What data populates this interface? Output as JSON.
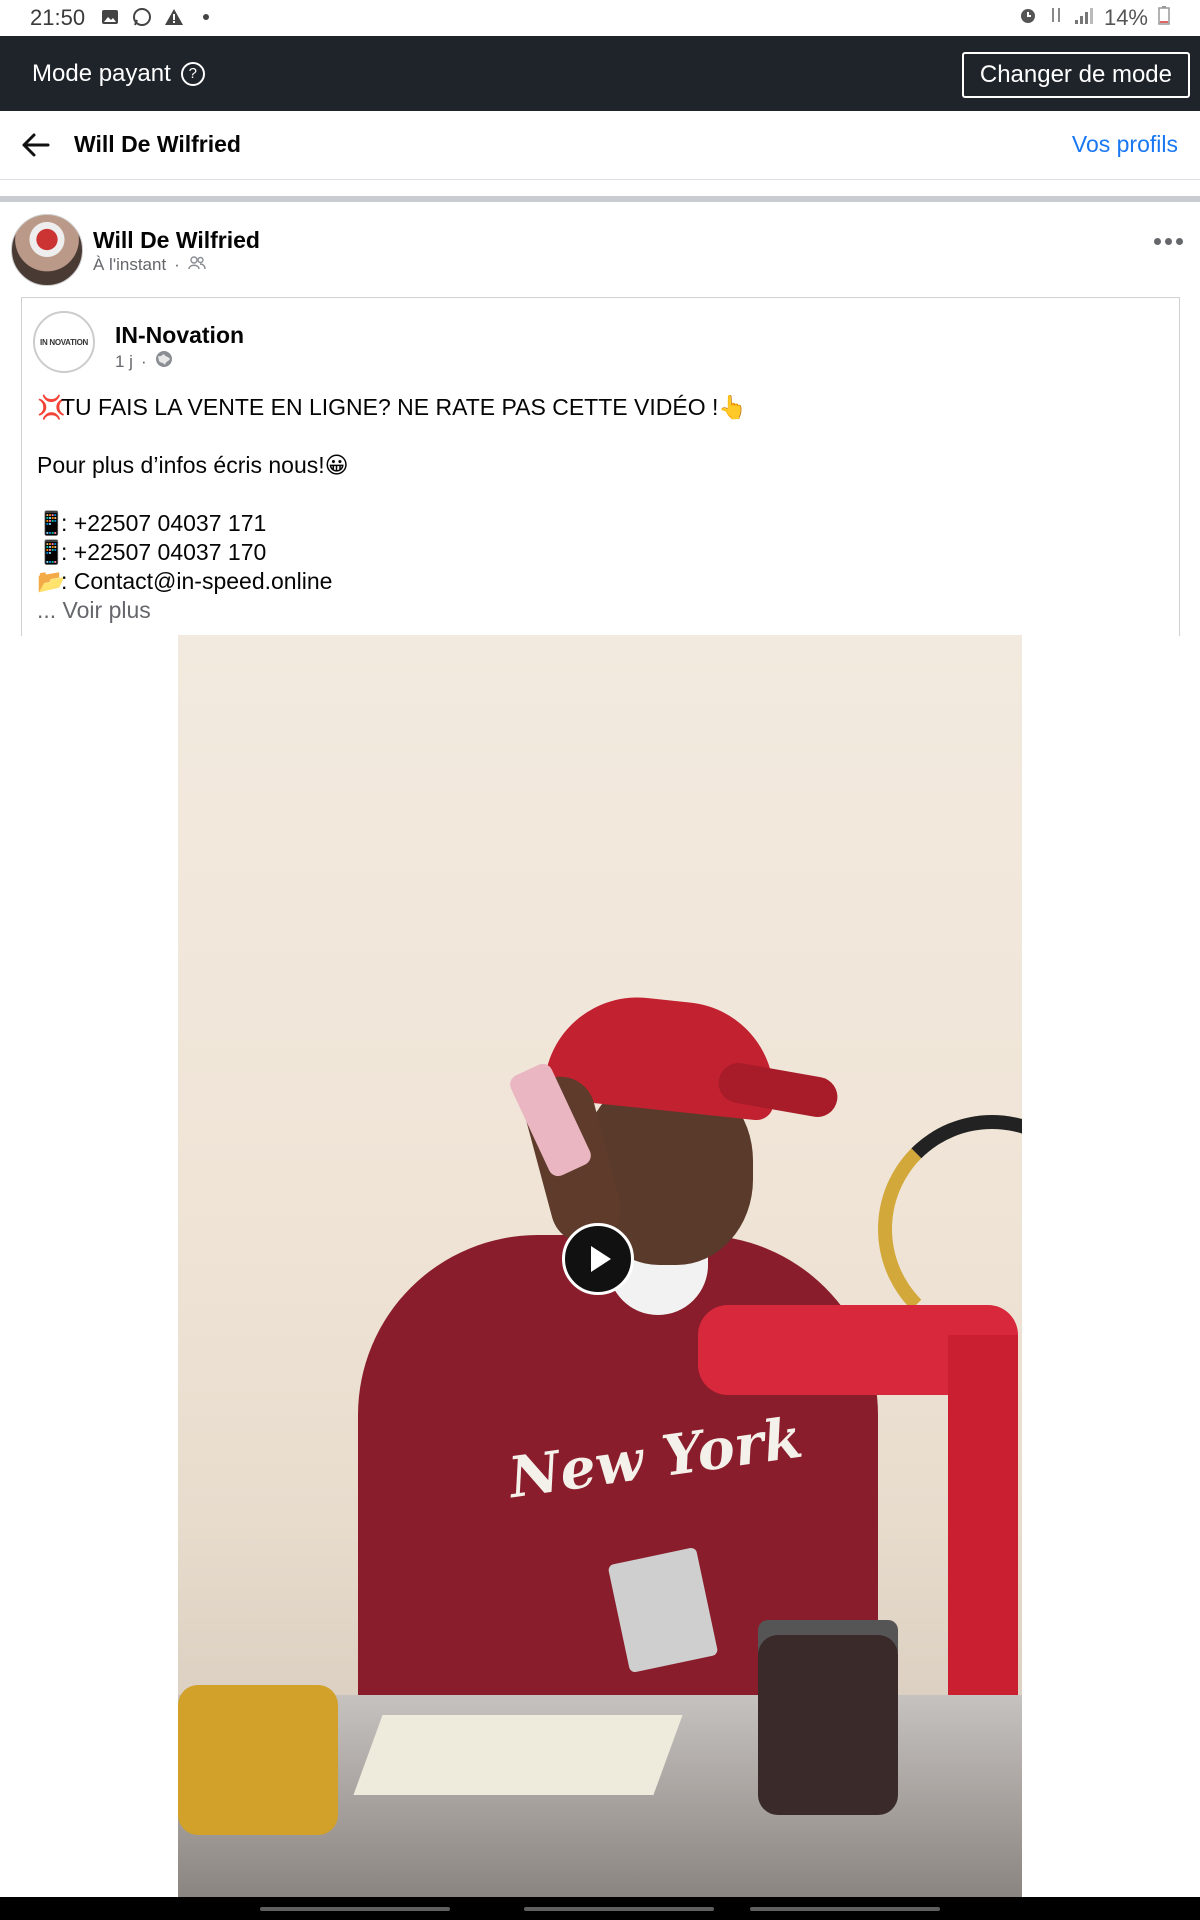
{
  "status_bar": {
    "time": "21:50",
    "left_icons": [
      "image-icon",
      "whatsapp-icon",
      "warning-icon",
      "dot-icon"
    ],
    "right_icons": [
      "alarm-icon",
      "data-icon",
      "signal-icon"
    ],
    "battery": "14%"
  },
  "mode_bar": {
    "label": "Mode payant",
    "help_icon": "?",
    "button": "Changer de mode"
  },
  "header": {
    "title": "Will De Wilfried",
    "link": "Vos profils"
  },
  "post": {
    "author": "Will De Wilfried",
    "time": "À l'instant",
    "separator": "·",
    "audience_icon": "friends-icon"
  },
  "shared": {
    "page_name": "IN-Novation",
    "avatar_text": "IN NOVATION",
    "time": "1 j",
    "separator": "·",
    "audience_icon": "globe-icon",
    "lines": [
      "TU FAIS LA VENTE EN LIGNE? NE RATE PAS CETTE VIDÉO !",
      "",
      "Pour plus d’infos écris nous!",
      "",
      ": +22507 04037 171",
      ": +22507 04037 170",
      ": Contact@in-speed.online"
    ],
    "see_more": "... Voir plus"
  },
  "video": {
    "overlay_text": "New York",
    "play_icon": "play-icon"
  },
  "colors": {
    "mode_bar_bg": "#1f232a",
    "link_blue": "#1877f2",
    "meta_gray": "#65676b"
  }
}
